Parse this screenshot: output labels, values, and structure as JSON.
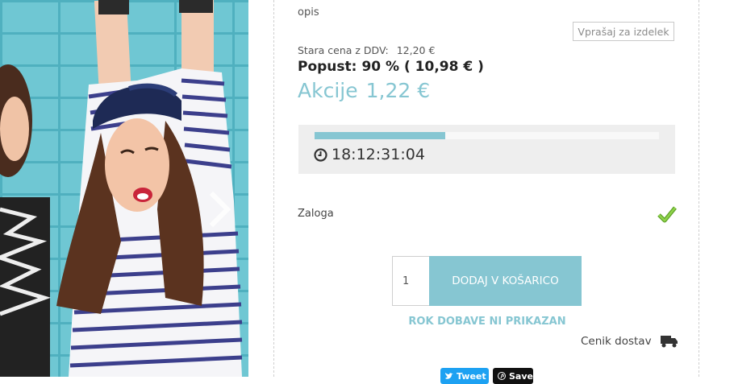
{
  "product": {
    "description_label": "opis",
    "ask_button_label": "Vprašaj za izdelek",
    "old_price_label": "Stara cena z DDV:",
    "old_price_value": "12,20 €",
    "discount_label": "Popust:",
    "discount_value": "90 % ( 10,98 € )",
    "sale_label": "Akcije",
    "sale_value": "1,22 €"
  },
  "countdown": {
    "time": "18:12:31:04",
    "progress_fraction": 0.38
  },
  "stock": {
    "label": "Zaloga",
    "icon": "checkmark-icon",
    "color": "#7fc53a"
  },
  "cart": {
    "quantity": "1",
    "add_button_label": "DODAJ V KOŠARICO",
    "delivery_note": "ROK DOBAVE NI PRIKAZAN",
    "shipping_link_label": "Cenik dostav",
    "shipping_icon": "truck-icon"
  },
  "share": {
    "tweet_label": "Tweet",
    "save_label": "Save"
  },
  "colors": {
    "accent": "#86c6d2",
    "timer_background": "#eeeeee",
    "tweet_blue": "#1da1f2"
  }
}
